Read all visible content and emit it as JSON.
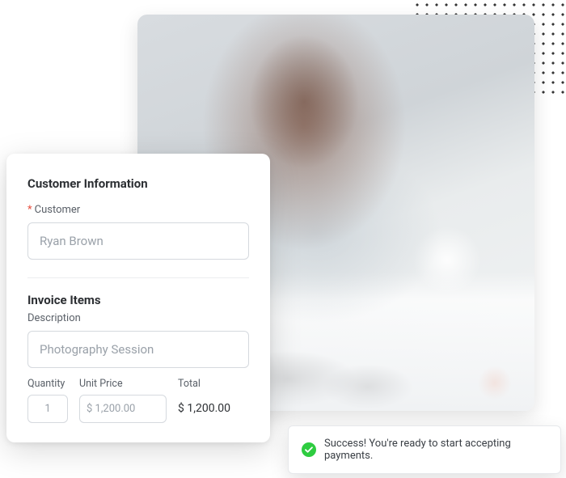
{
  "customerSection": {
    "title": "Customer Information",
    "customerLabel": "Customer",
    "customerValue": "Ryan Brown"
  },
  "invoiceSection": {
    "title": "Invoice Items",
    "descriptionLabel": "Description",
    "descriptionValue": "Photography Session",
    "quantityLabel": "Quantity",
    "quantityValue": "1",
    "unitPriceLabel": "Unit Price",
    "unitPriceValue": "$ 1,200.00",
    "totalLabel": "Total",
    "totalValue": "$ 1,200.00"
  },
  "toast": {
    "message": "Success! You're ready to start accepting payments."
  }
}
